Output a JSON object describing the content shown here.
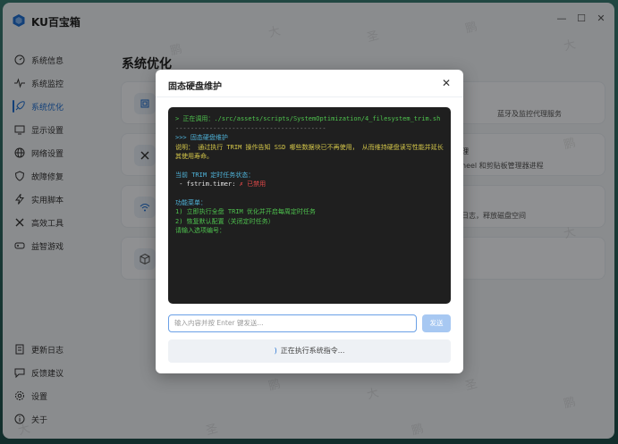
{
  "app": {
    "title": "KU百宝箱",
    "logo_color": "#1f6fd1"
  },
  "window_controls": {
    "minimize": "—",
    "maximize": "☐",
    "close": "✕"
  },
  "sidebar": {
    "items": [
      {
        "label": "系统信息",
        "icon": "dashboard-icon"
      },
      {
        "label": "系统监控",
        "icon": "pulse-icon"
      },
      {
        "label": "系统优化",
        "icon": "rocket-icon",
        "active": true
      },
      {
        "label": "显示设置",
        "icon": "monitor-icon"
      },
      {
        "label": "网络设置",
        "icon": "globe-icon"
      },
      {
        "label": "故障修复",
        "icon": "shield-icon"
      },
      {
        "label": "实用脚本",
        "icon": "bolt-icon"
      },
      {
        "label": "高效工具",
        "icon": "tools-icon"
      },
      {
        "label": "益智游戏",
        "icon": "gamepad-icon"
      }
    ],
    "bottom_items": [
      {
        "label": "更新日志",
        "icon": "document-icon"
      },
      {
        "label": "反馈建议",
        "icon": "chat-icon"
      },
      {
        "label": "设置",
        "icon": "gear-icon"
      },
      {
        "label": "关于",
        "icon": "info-icon"
      }
    ]
  },
  "main": {
    "title": "系统优化",
    "cards": [
      {
        "icon": "chip-icon",
        "desc": "蓝牙及监控代理服务"
      },
      {
        "icon": "wrench-icon",
        "desc_top": "理",
        "desc": "heel 和剪贴板管理器进程"
      },
      {
        "icon": "wifi-icon",
        "desc": "日志，释放磁盘空间"
      },
      {
        "icon": "cube-icon",
        "desc": ""
      }
    ]
  },
  "dialog": {
    "title": "固态硬盘维护",
    "terminal_lines": {
      "call_prefix": "> 正在调用：",
      "call_path": "./src/assets/scripts/SystemOptimization/4_filesystem_trim.sh",
      "separator": "----------------------------------------",
      "section_title": ">>> 固态硬盘维护",
      "description": "说明： 通过执行 TRIM 操作告知 SSD 哪些数据块已不再使用， 从而维持硬盘读写性能并延长其使用寿命。",
      "status_title": "当前 TRIM 定时任务状态：",
      "status_item": " - fstrim.timer: ",
      "status_value": "✗ 已禁用",
      "menu_title": "功能菜单：",
      "menu_1": "1) 立即执行全盘 TRIM 优化并开启每周定时任务",
      "menu_2": "2) 恢复默认配置（关闭定时任务）",
      "prompt": "请输入选项编号："
    },
    "input_placeholder": "输入内容并按 Enter 键发送...",
    "send_label": "发送",
    "status_text": "正在执行系统指令...",
    "status_spinner": ")"
  },
  "watermark": {
    "glyphs": [
      "鹏",
      "大",
      "圣"
    ]
  }
}
